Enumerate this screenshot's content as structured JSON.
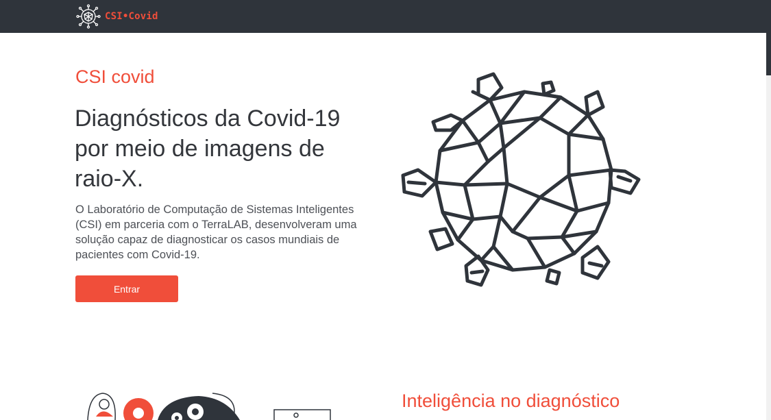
{
  "navbar": {
    "brand": "CSI•Covid",
    "logo_icon": "virus-logo-icon"
  },
  "hero": {
    "eyebrow": "CSI covid",
    "headline": "Diagnósticos da Covid-19 por meio de imagens de raio-X.",
    "description": "O Laboratório de Computação de Sistemas Inteligentes (CSI) em parceria com o TerraLAB, desenvolveram uma solução capaz de diagnosticar os casos mundiais de pacientes com Covid-19.",
    "button_label": "Entrar",
    "illustration_icon": "coronavirus-illustration"
  },
  "section2": {
    "title": "Inteligência no diagnóstico",
    "illustration_icon": "people-gears-illustration"
  },
  "colors": {
    "accent": "#f04e3a",
    "navbar": "#2f343b",
    "text": "#33363b"
  }
}
